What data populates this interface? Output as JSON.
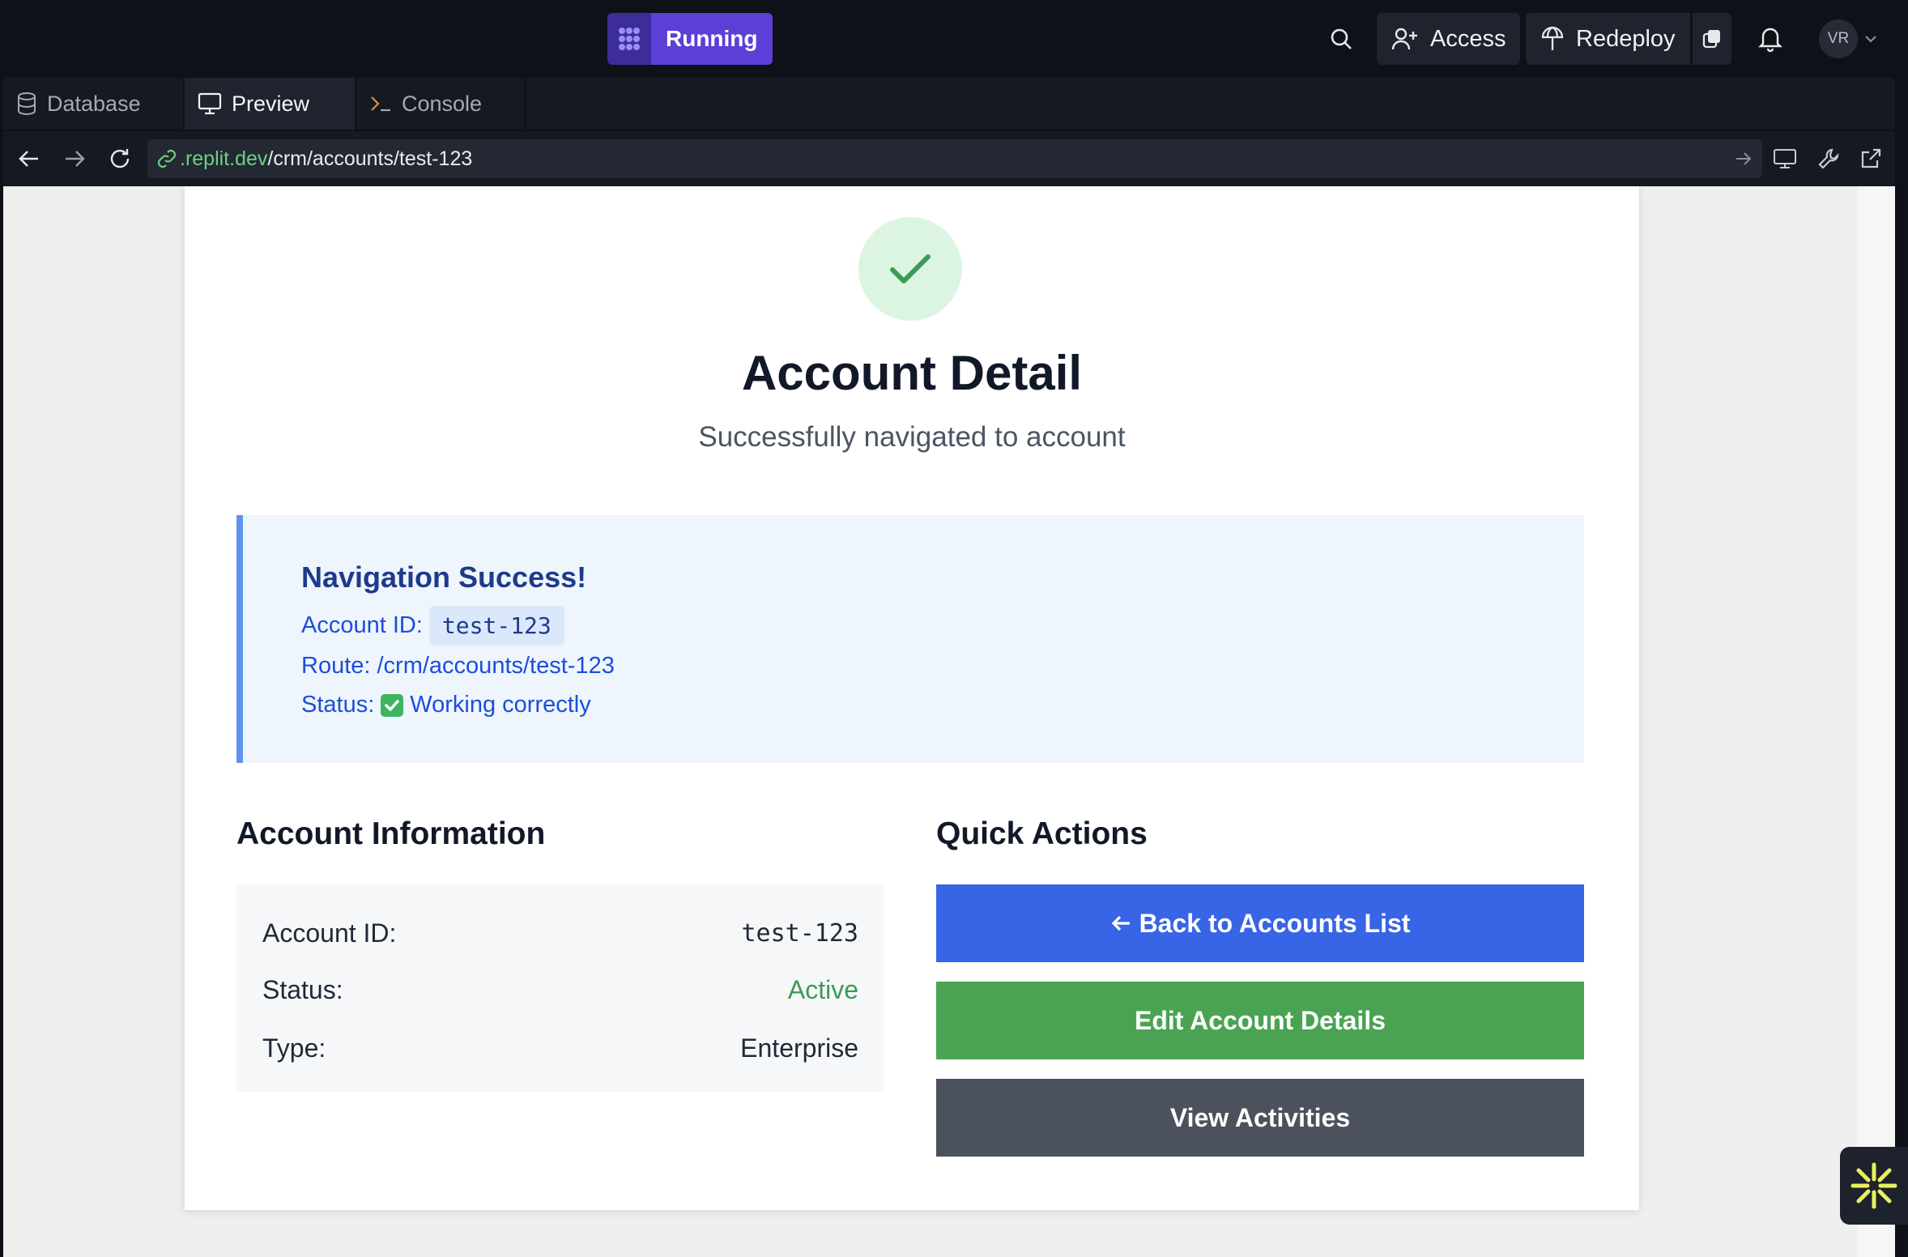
{
  "topbar": {
    "status_label": "Running",
    "access_label": "Access",
    "redeploy_label": "Redeploy",
    "avatar_initials": "VR"
  },
  "tabs": [
    {
      "label": "Database",
      "icon": "database-icon"
    },
    {
      "label": "Preview",
      "icon": "monitor-icon",
      "active": true
    },
    {
      "label": "Console",
      "icon": "terminal-icon"
    }
  ],
  "url": {
    "host": ".replit.dev",
    "path": "/crm/accounts/test-123"
  },
  "page": {
    "title": "Account Detail",
    "subtitle": "Successfully navigated to account",
    "notice": {
      "title": "Navigation Success!",
      "account_label": "Account ID:",
      "account_value": "test-123",
      "route_text": "Route: /crm/accounts/test-123",
      "status_label": "Status:",
      "status_value": "Working correctly"
    },
    "info": {
      "heading": "Account Information",
      "rows": [
        {
          "label": "Account ID:",
          "value": "test-123"
        },
        {
          "label": "Status:",
          "value": "Active"
        },
        {
          "label": "Type:",
          "value": "Enterprise"
        }
      ]
    },
    "actions": {
      "heading": "Quick Actions",
      "back_label": "Back to Accounts List",
      "edit_label": "Edit Account Details",
      "activities_label": "View Activities"
    }
  },
  "colors": {
    "running": "#5b3fd6",
    "primary_blue": "#3864e6",
    "success_green": "#4aa352",
    "neutral_gray": "#4b515d",
    "url_host_green": "#6cd07f"
  }
}
